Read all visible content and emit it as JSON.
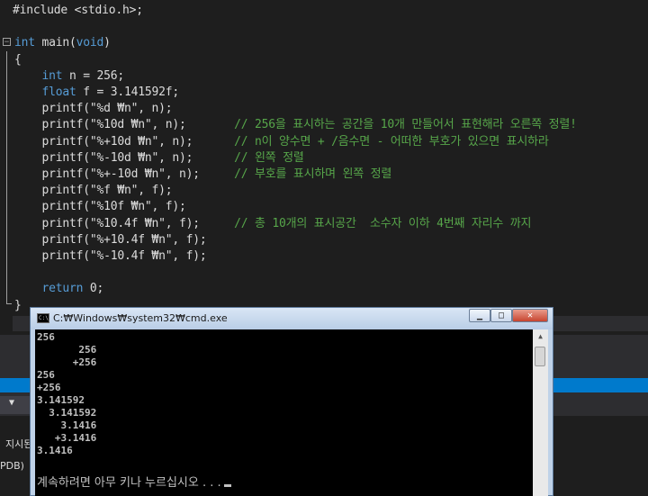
{
  "editor": {
    "lines": [
      [
        {
          "c": "tx",
          "t": "#include <stdio.h>;"
        }
      ],
      [],
      [
        {
          "c": "kw",
          "t": "int"
        },
        {
          "c": "tx",
          "t": " main("
        },
        {
          "c": "kw",
          "t": "void"
        },
        {
          "c": "tx",
          "t": ")"
        }
      ],
      [
        {
          "c": "tx",
          "t": "{"
        }
      ],
      [
        {
          "c": "tx",
          "t": "    "
        },
        {
          "c": "kw",
          "t": "int"
        },
        {
          "c": "tx",
          "t": " n = 256;"
        }
      ],
      [
        {
          "c": "tx",
          "t": "    "
        },
        {
          "c": "kw",
          "t": "float"
        },
        {
          "c": "tx",
          "t": " f = 3.141592f;"
        }
      ],
      [
        {
          "c": "tx",
          "t": "    printf(\"%d ₩n\", n);"
        }
      ],
      [
        {
          "c": "tx",
          "t": "    printf(\"%10d ₩n\", n);       "
        },
        {
          "c": "cm",
          "t": "// 256을 표시하는 공간을 10개 만들어서 표현해라 오른쪽 정렬!"
        }
      ],
      [
        {
          "c": "tx",
          "t": "    printf(\"%+10d ₩n\", n);      "
        },
        {
          "c": "cm",
          "t": "// n이 양수면 + /음수면 - 어떠한 부호가 있으면 표시하라"
        }
      ],
      [
        {
          "c": "tx",
          "t": "    printf(\"%-10d ₩n\", n);      "
        },
        {
          "c": "cm",
          "t": "// 왼쪽 정렬"
        }
      ],
      [
        {
          "c": "tx",
          "t": "    printf(\"%+-10d ₩n\", n);     "
        },
        {
          "c": "cm",
          "t": "// 부호를 표시하며 왼쪽 정렬"
        }
      ],
      [
        {
          "c": "tx",
          "t": "    printf(\"%f ₩n\", f);"
        }
      ],
      [
        {
          "c": "tx",
          "t": "    printf(\"%10f ₩n\", f);"
        }
      ],
      [
        {
          "c": "tx",
          "t": "    printf(\"%10.4f ₩n\", f);     "
        },
        {
          "c": "cm",
          "t": "// 총 10개의 표시공간  소수자 이하 4번째 자리수 까지"
        }
      ],
      [
        {
          "c": "tx",
          "t": "    printf(\"%+10.4f ₩n\", f);"
        }
      ],
      [
        {
          "c": "tx",
          "t": "    printf(\"%-10.4f ₩n\", f);"
        }
      ],
      [],
      [
        {
          "c": "tx",
          "t": "    "
        },
        {
          "c": "kw",
          "t": "return"
        },
        {
          "c": "tx",
          "t": " 0;"
        }
      ],
      [
        {
          "c": "tx",
          "t": "}"
        }
      ]
    ]
  },
  "cmd_window": {
    "title": "C:₩Windows₩system32₩cmd.exe",
    "icon": "cmd-icon",
    "minimize_glyph": "▁",
    "maximize_glyph": "□",
    "close_glyph": "✕",
    "output_lines": [
      "256",
      "       256",
      "      +256",
      "256",
      "+256",
      "3.141592",
      "  3.141592",
      "    3.1416",
      "   +3.1416",
      "3.1416"
    ],
    "prompt": "계속하려면 아무 키나 누르십시오 . . ."
  },
  "background_panel": {
    "label_left": "지시된",
    "label_pdb": "PDB)"
  }
}
